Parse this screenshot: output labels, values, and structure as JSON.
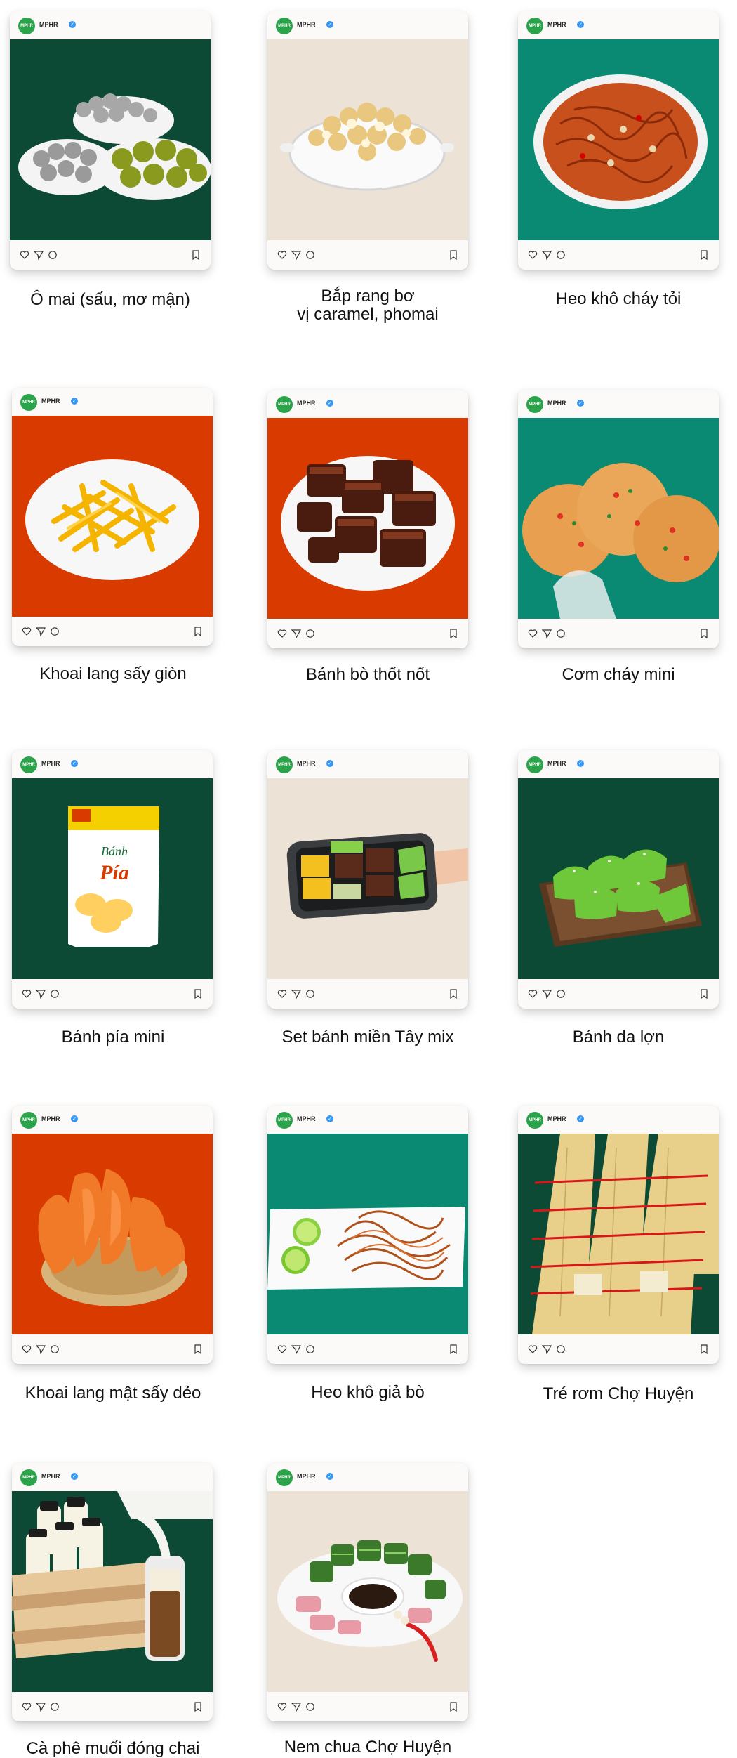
{
  "account": {
    "username": "MPHR",
    "avatar_text": "MPHR"
  },
  "colors": {
    "dark_green": "#0d4a36",
    "teal": "#0a8a72",
    "orange_red": "#d83a00",
    "beige": "#ede2d6"
  },
  "action_icons": [
    "heart-icon",
    "send-icon",
    "comment-icon",
    "bookmark-icon"
  ],
  "products": [
    {
      "caption": "Ô mai (sấu, mơ mận)",
      "background": "dark_green"
    },
    {
      "caption": "Bắp rang bơ",
      "caption_line2": "vị caramel, phomai",
      "background": "beige"
    },
    {
      "caption": "Heo khô cháy tỏi",
      "background": "teal"
    },
    {
      "caption": "Khoai lang sấy giòn",
      "background": "orange_red"
    },
    {
      "caption": "Bánh bò thốt nốt",
      "background": "orange_red"
    },
    {
      "caption": "Cơm cháy mini",
      "background": "teal"
    },
    {
      "caption": "Bánh pía mini",
      "background": "dark_green",
      "package_brand": "Bánh",
      "package_name": "Pía"
    },
    {
      "caption": "Set bánh miền Tây mix",
      "background": "beige"
    },
    {
      "caption": "Bánh da lợn",
      "background": "dark_green"
    },
    {
      "caption": "Khoai lang mật sấy dẻo",
      "background": "orange_red"
    },
    {
      "caption": "Heo khô giả bò",
      "background": "teal"
    },
    {
      "caption": "Tré rơm Chợ Huyện",
      "background": "dark_green"
    },
    {
      "caption": "Cà phê muối đóng chai",
      "background": "dark_green"
    },
    {
      "caption": "Nem chua Chợ Huyện",
      "background": "beige"
    }
  ]
}
